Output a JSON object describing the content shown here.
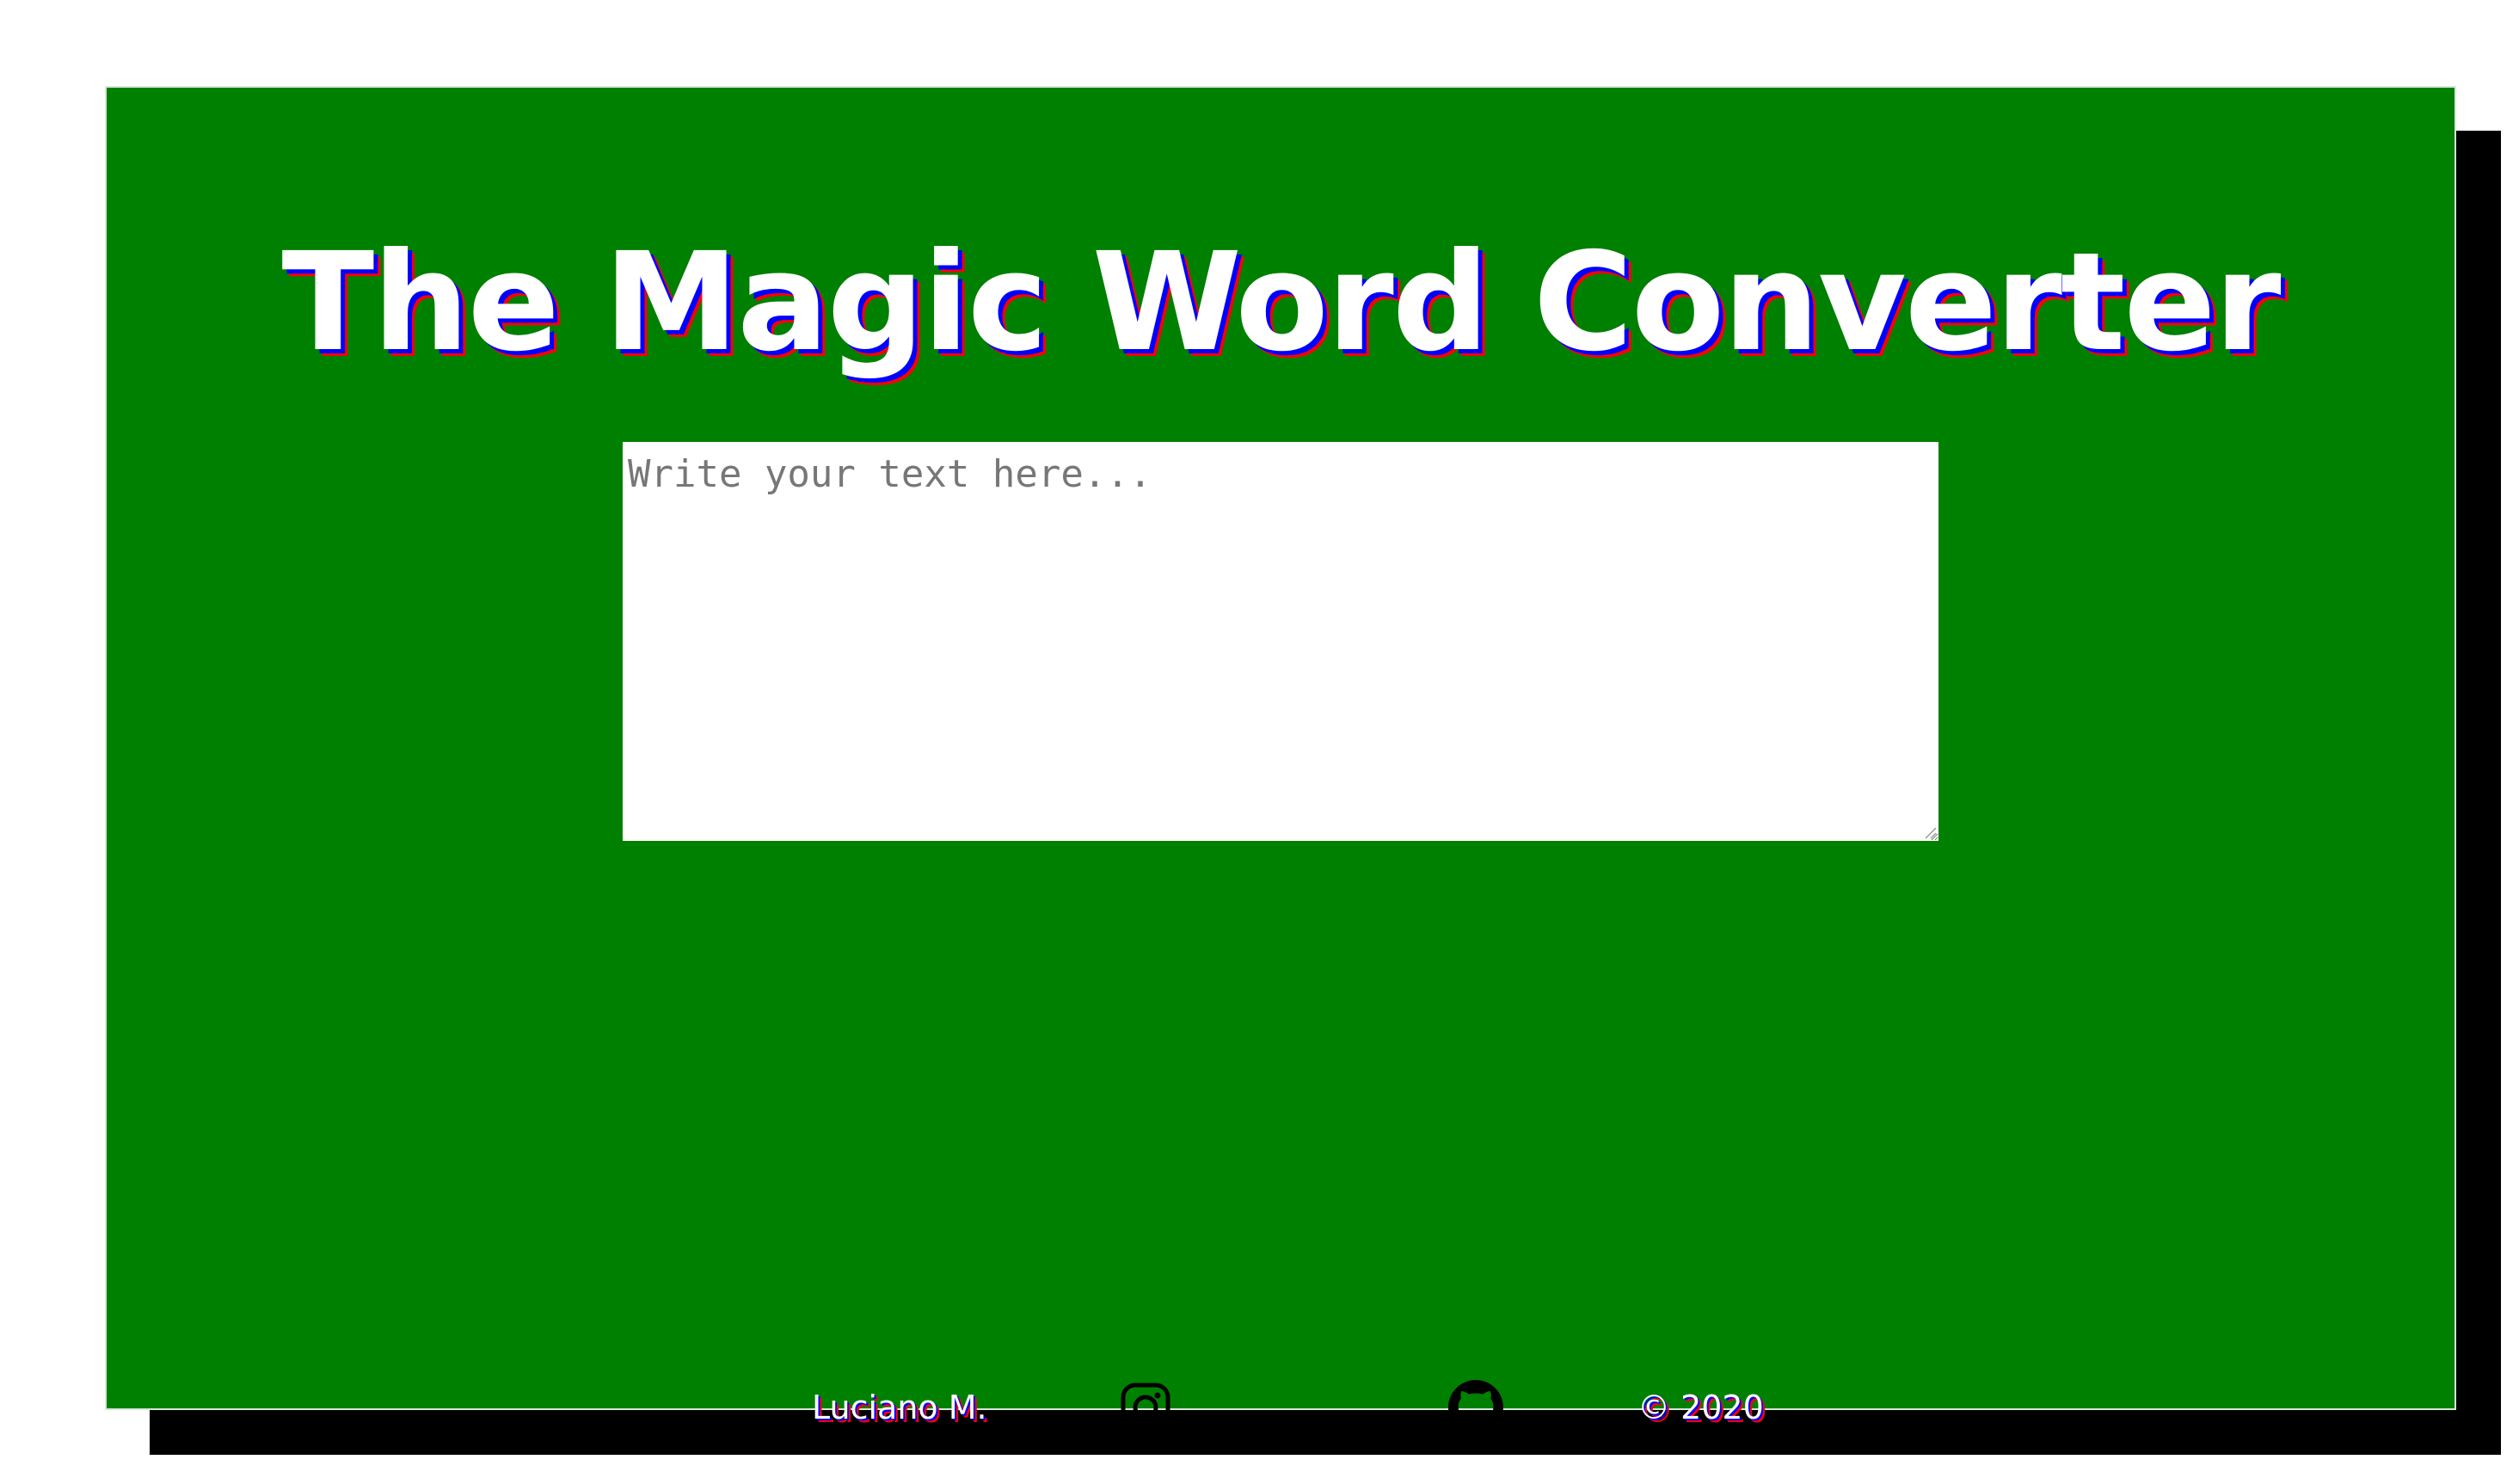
{
  "header": {
    "title": "The Magic Word Converter"
  },
  "editor": {
    "placeholder": "Write your text here...",
    "value": ""
  },
  "footer": {
    "author": "Luciano M.",
    "copyright": "© 2020",
    "icons": [
      "instagram-icon",
      "github-icon"
    ]
  },
  "colors": {
    "background": "#ffffff",
    "card": "#008000",
    "shadow": "#000000",
    "title_text": "#ffffff",
    "text_shadow_blue": "#0000ff",
    "text_shadow_red": "#ff0000"
  }
}
